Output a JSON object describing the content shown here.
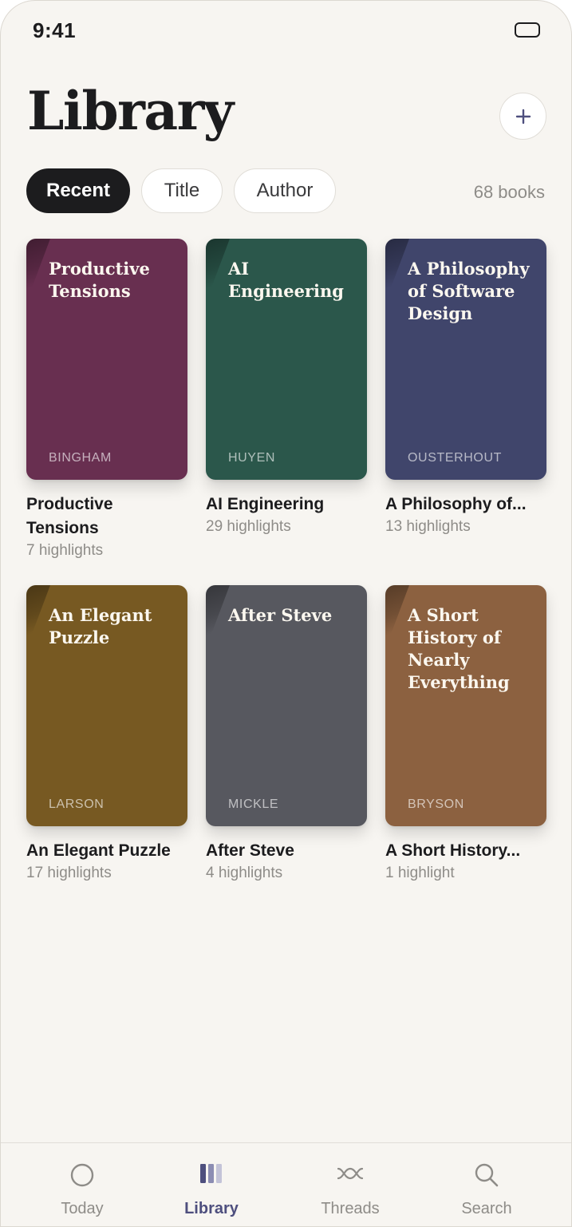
{
  "status_bar": {
    "time": "9:41"
  },
  "header": {
    "title": "Library",
    "add_icon": "plus-icon"
  },
  "sort": {
    "tabs": [
      {
        "label": "Recent",
        "active": true
      },
      {
        "label": "Title",
        "active": false
      },
      {
        "label": "Author",
        "active": false
      }
    ],
    "count": "68 books"
  },
  "books": [
    {
      "cover_title": "Productive Tensions",
      "author": "BINGHAM",
      "title": "Productive Tensions",
      "highlights": "7 highlights",
      "color": "#682f50"
    },
    {
      "cover_title": "AI Engineering",
      "author": "HUYEN",
      "title": "AI Engineering",
      "highlights": "29 highlights",
      "color": "#2b574b"
    },
    {
      "cover_title": "A Philosophy of Software Design",
      "author": "OUSTERHOUT",
      "title": "A Philosophy of...",
      "highlights": "13 highlights",
      "color": "#40456b"
    },
    {
      "cover_title": "An Elegant Puzzle",
      "author": "LARSON",
      "title": "An Elegant Puzzle",
      "highlights": "17 highlights",
      "color": "#775922"
    },
    {
      "cover_title": "After Steve",
      "author": "MICKLE",
      "title": "After Steve",
      "highlights": "4 highlights",
      "color": "#57585f"
    },
    {
      "cover_title": "A Short History of Nearly Everything",
      "author": "BRYSON",
      "title": "A Short History...",
      "highlights": "1 highlight",
      "color": "#8c6140"
    }
  ],
  "tab_bar": {
    "items": [
      {
        "label": "Today",
        "icon": "circle-icon",
        "active": false
      },
      {
        "label": "Library",
        "icon": "books-icon",
        "active": true
      },
      {
        "label": "Threads",
        "icon": "threads-icon",
        "active": false
      },
      {
        "label": "Search",
        "icon": "search-icon",
        "active": false
      }
    ]
  },
  "colors": {
    "accent": "#4e4f7e",
    "background": "#f7f5f1",
    "text": "#1c1c1e",
    "muted": "#8e8c88"
  }
}
